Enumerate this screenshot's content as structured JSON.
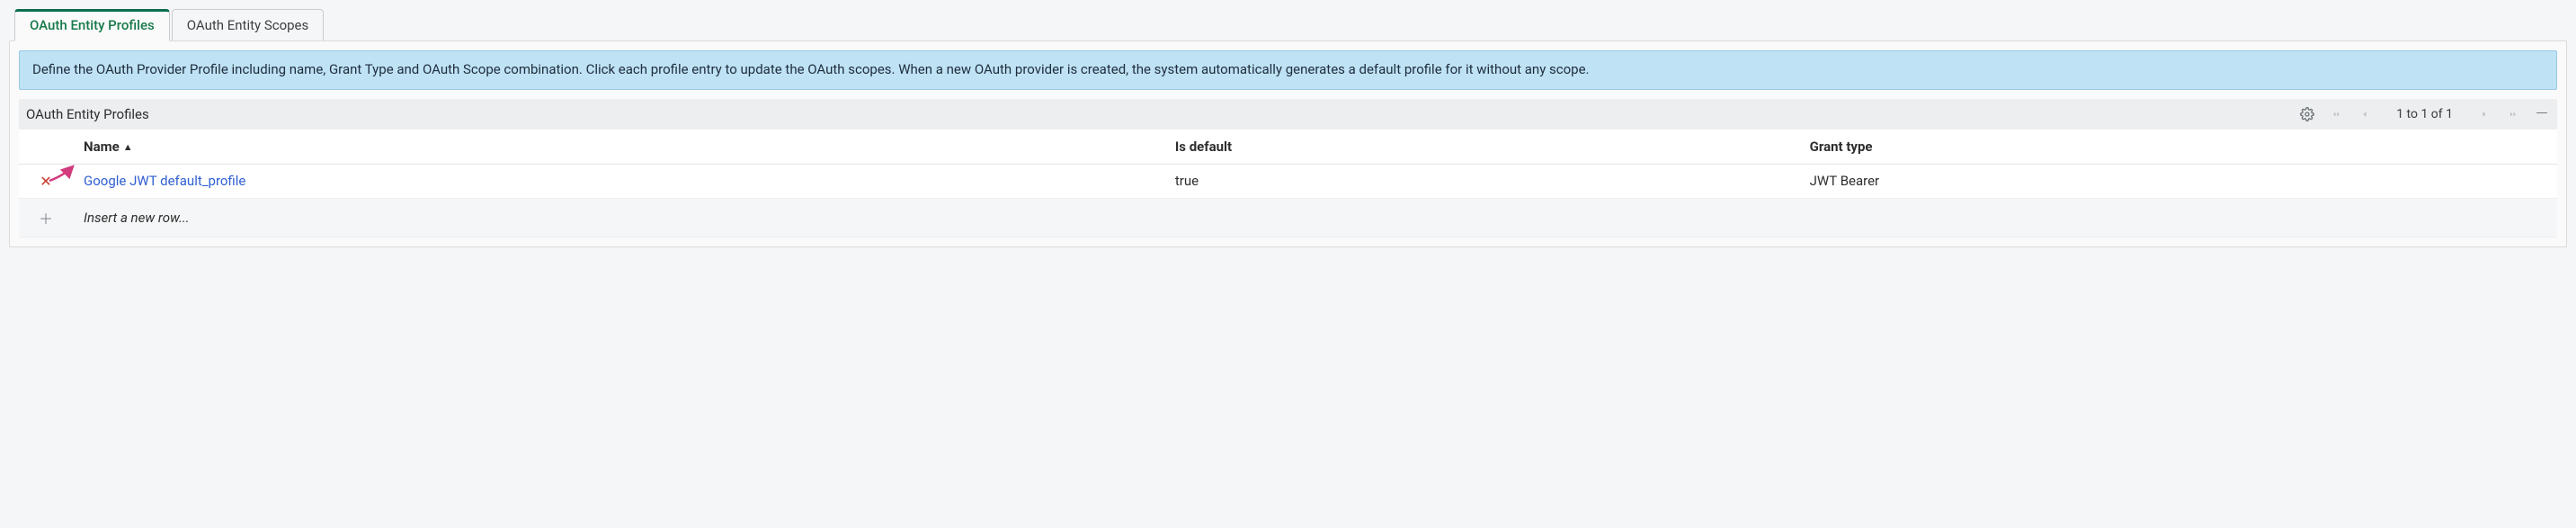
{
  "tabs": {
    "profiles": "OAuth Entity Profiles",
    "scopes": "OAuth Entity Scopes"
  },
  "info_text": "Define the OAuth Provider Profile including name, Grant Type and OAuth Scope combination. Click each profile entry to update the OAuth scopes. When a new OAuth provider is created, the system automatically generates a default profile for it without any scope.",
  "list": {
    "title": "OAuth Entity Profiles",
    "pagination": "1   to 1 of 1"
  },
  "columns": {
    "name": "Name",
    "is_default": "Is default",
    "grant_type": "Grant type"
  },
  "rows": [
    {
      "name": "Google JWT default_profile",
      "is_default": "true",
      "grant_type": "JWT Bearer"
    }
  ],
  "insert_row_text": "Insert a new row..."
}
